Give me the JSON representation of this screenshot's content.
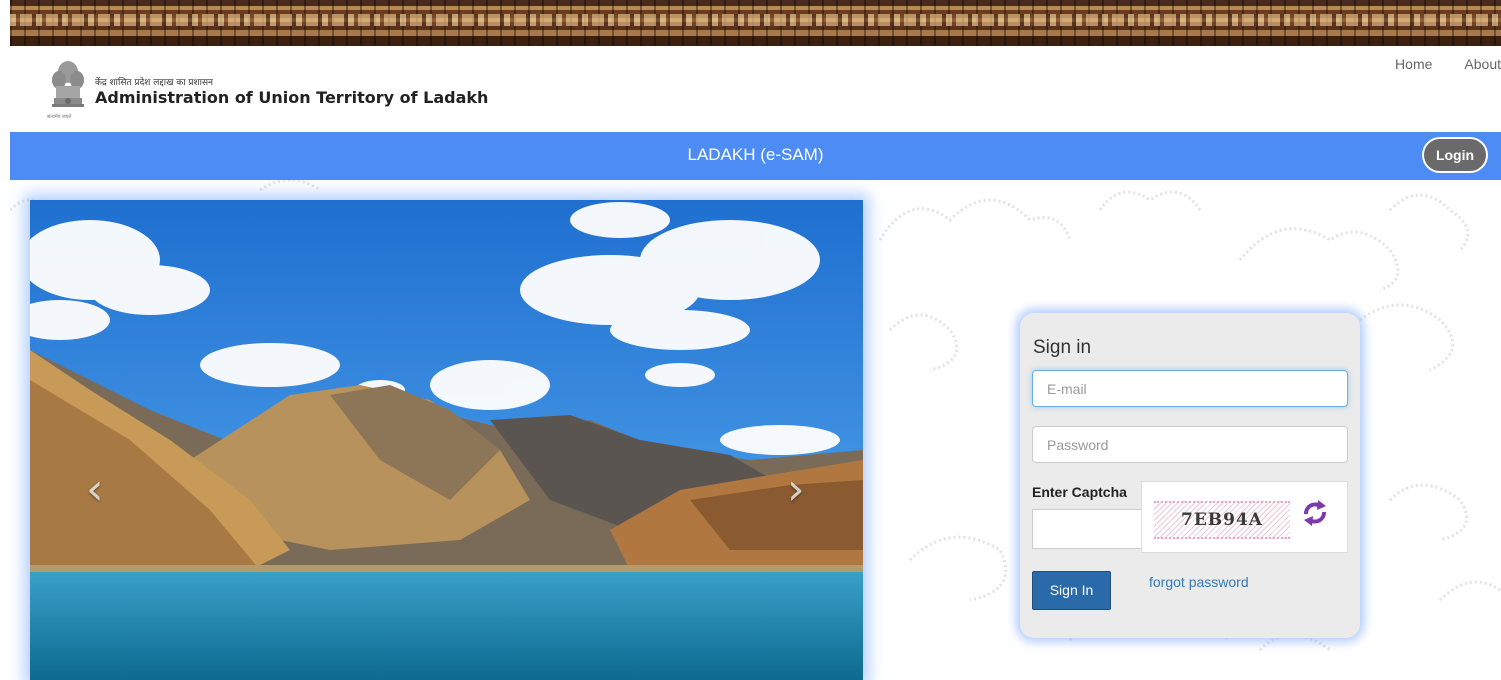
{
  "header": {
    "org_hindi": "केंद्र शासित प्रदेश लद्दाख का प्रशासन",
    "org_english": "Administration of Union Territory of Ladakh",
    "emblem_caption": "सत्यमेव जयते",
    "nav": [
      {
        "label": "Home"
      },
      {
        "label": "About"
      }
    ]
  },
  "titlebar": {
    "title": "LADAKH (e-SAM)",
    "login_label": "Login",
    "color": "#4c8cf4"
  },
  "carousel": {
    "prev_icon": "chevron-left-icon",
    "next_icon": "chevron-right-icon",
    "prev_glyph": "‹",
    "next_glyph": "›"
  },
  "signin": {
    "title": "Sign in",
    "email_placeholder": "E-mail",
    "password_placeholder": "Password",
    "captcha_label": "Enter Captcha",
    "captcha_text": "7EB94A",
    "submit_label": "Sign In",
    "forgot_label": "forgot password",
    "button_color": "#2b6aa8",
    "link_color": "#337ab7"
  }
}
